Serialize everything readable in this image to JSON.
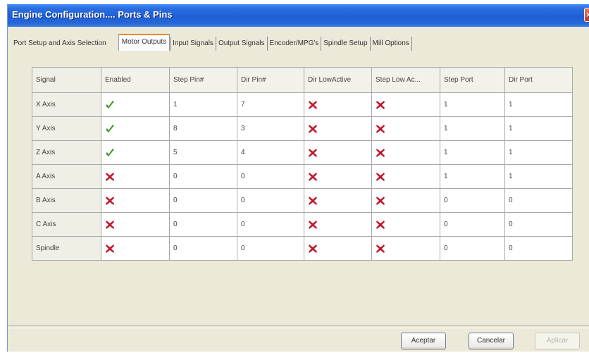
{
  "window": {
    "title": "Engine Configuration.... Ports & Pins"
  },
  "tabs": [
    {
      "label": "Port Setup and Axis Selection",
      "active": false
    },
    {
      "label": "Motor Outputs",
      "active": true
    },
    {
      "label": "Input Signals",
      "active": false
    },
    {
      "label": "Output Signals",
      "active": false
    },
    {
      "label": "Encoder/MPG's",
      "active": false
    },
    {
      "label": "Spindle Setup",
      "active": false
    },
    {
      "label": "Mill Options",
      "active": false
    }
  ],
  "table": {
    "columns": [
      "Signal",
      "Enabled",
      "Step Pin#",
      "Dir Pin#",
      "Dir LowActive",
      "Step Low Ac...",
      "Step Port",
      "Dir Port"
    ],
    "rows": [
      {
        "signal": "X Axis",
        "enabled": "check-icon",
        "step_pin": "1",
        "dir_pin": "7",
        "dir_low": "x-icon",
        "step_low": "x-icon",
        "step_port": "1",
        "dir_port": "1"
      },
      {
        "signal": "Y Axis",
        "enabled": "check-icon",
        "step_pin": "8",
        "dir_pin": "3",
        "dir_low": "x-icon",
        "step_low": "x-icon",
        "step_port": "1",
        "dir_port": "1"
      },
      {
        "signal": "Z Axis",
        "enabled": "check-icon",
        "step_pin": "5",
        "dir_pin": "4",
        "dir_low": "x-icon",
        "step_low": "x-icon",
        "step_port": "1",
        "dir_port": "1"
      },
      {
        "signal": "A Axis",
        "enabled": "x-icon",
        "step_pin": "0",
        "dir_pin": "0",
        "dir_low": "x-icon",
        "step_low": "x-icon",
        "step_port": "1",
        "dir_port": "1"
      },
      {
        "signal": "B Axis",
        "enabled": "x-icon",
        "step_pin": "0",
        "dir_pin": "0",
        "dir_low": "x-icon",
        "step_low": "x-icon",
        "step_port": "0",
        "dir_port": "0"
      },
      {
        "signal": "C Axis",
        "enabled": "x-icon",
        "step_pin": "0",
        "dir_pin": "0",
        "dir_low": "x-icon",
        "step_low": "x-icon",
        "step_port": "0",
        "dir_port": "0"
      },
      {
        "signal": "Spindle",
        "enabled": "x-icon",
        "step_pin": "0",
        "dir_pin": "0",
        "dir_low": "x-icon",
        "step_low": "x-icon",
        "step_port": "0",
        "dir_port": "0"
      }
    ]
  },
  "buttons": {
    "accept": "Aceptar",
    "cancel": "Cancelar",
    "apply": "Aplicar"
  },
  "colors": {
    "titlebar": "#2a6de0",
    "check": "#3a9a2a",
    "x_mark": "#c0182a"
  }
}
